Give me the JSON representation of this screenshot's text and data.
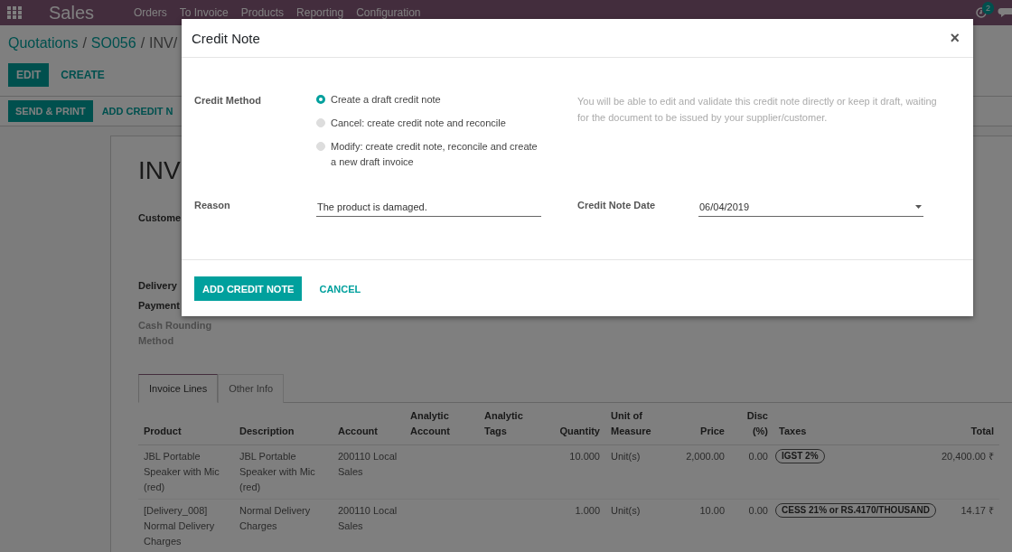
{
  "navbar": {
    "app_name": "Sales",
    "menu": [
      "Orders",
      "To Invoice",
      "Products",
      "Reporting",
      "Configuration"
    ],
    "activity_count": "2"
  },
  "breadcrumb": [
    {
      "label": "Quotations",
      "separator": "/"
    },
    {
      "label": "SO056",
      "separator": "/"
    },
    {
      "label": "INV/"
    }
  ],
  "actions": [
    "EDIT",
    "CREATE"
  ],
  "invoice_actions": [
    "SEND & PRINT",
    "ADD CREDIT N"
  ],
  "invoice": {
    "title": "INV",
    "fields": [
      {
        "label": "Custome",
        "kind": "bold"
      },
      {
        "label": "Delivery",
        "kind": "bold"
      },
      {
        "label": "Payment",
        "kind": "bold"
      },
      {
        "label": "Cash Rounding Method",
        "kind": "muted"
      }
    ]
  },
  "tabs": [
    {
      "label": "Invoice Lines",
      "selected": true
    },
    {
      "label": "Other Info",
      "selected": false
    }
  ],
  "table": {
    "columns": [
      {
        "label": "Product",
        "kind": "text"
      },
      {
        "label": "Description",
        "kind": "text"
      },
      {
        "label": "Account",
        "kind": "text"
      },
      {
        "label": "Analytic Account",
        "kind": "text"
      },
      {
        "label": "Analytic Tags",
        "kind": "text"
      },
      {
        "label": "Quantity",
        "kind": "number"
      },
      {
        "label": "Unit of Measure",
        "kind": "text"
      },
      {
        "label": "Price",
        "kind": "number"
      },
      {
        "label": "Disc (%)",
        "kind": "number"
      },
      {
        "label": "Taxes",
        "kind": "text"
      },
      {
        "label": "Total",
        "kind": "number"
      }
    ],
    "rows": [
      {
        "product": "JBL Portable Speaker with Mic (red)",
        "description": "JBL Portable Speaker with Mic (red)",
        "account": "200110 Local Sales",
        "quantity": "10.000",
        "unit": "Unit(s)",
        "price": "2,000.00",
        "discount": "0.00",
        "taxes": [
          "IGST 2%"
        ],
        "total": "20,400.00 ₹"
      },
      {
        "product": "[Delivery_008] Normal Delivery Charges",
        "description": "Normal Delivery Charges",
        "account": "200110 Local Sales",
        "quantity": "1.000",
        "unit": "Unit(s)",
        "price": "10.00",
        "discount": "0.00",
        "taxes": [
          "CESS 21% or RS.4170/THOUSAND"
        ],
        "total": "14.17 ₹"
      }
    ]
  },
  "dialog": {
    "title": "Credit Note",
    "close": "×",
    "credit_method": {
      "label": "Credit Method",
      "options": [
        {
          "label": "Create a draft credit note",
          "selected": true
        },
        {
          "label": "Cancel: create credit note and reconcile",
          "selected": false
        },
        {
          "label": "Modify: create credit note, reconcile and create a new draft invoice",
          "selected": false
        }
      ],
      "help": "You will be able to edit and validate this credit note directly or keep it draft, waiting for the document to be issued by your supplier/customer."
    },
    "reason": {
      "label": "Reason",
      "value": "The product is damaged."
    },
    "date": {
      "label": "Credit Note Date",
      "value": "06/04/2019"
    },
    "buttons": [
      {
        "label": "ADD CREDIT NOTE",
        "kind": "primary"
      },
      {
        "label": "CANCEL",
        "kind": "link"
      }
    ]
  }
}
